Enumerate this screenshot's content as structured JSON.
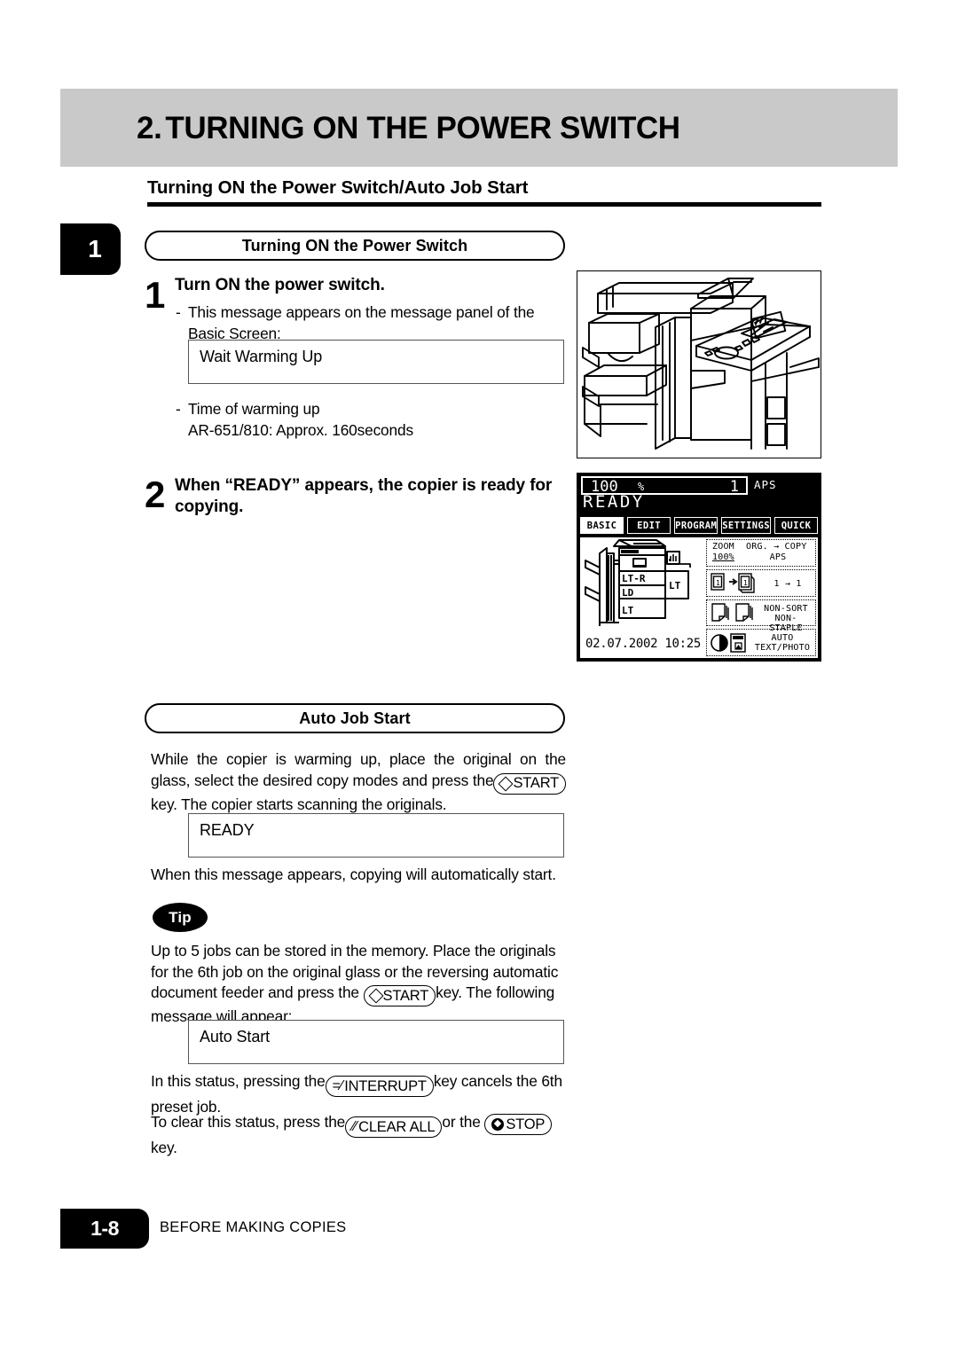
{
  "header": {
    "chapter_number": "2.",
    "title": "TURNING ON THE POWER SWITCH",
    "subtitle": "Turning ON the Power Switch/Auto Job Start",
    "chapter_tab": "1"
  },
  "sections": {
    "power_switch_pill": "Turning ON the Power Switch",
    "auto_job_start_pill": "Auto Job Start"
  },
  "step1": {
    "number": "1",
    "heading": "Turn ON the power switch.",
    "bullet1_dash": "-",
    "bullet1": "This message appears on the message panel of the Basic Screen:",
    "message": "Wait  Warming Up",
    "bullet2_dash": "-",
    "bullet2": "Time of warming up",
    "bullet2_detail": "AR-651/810: Approx. 160seconds"
  },
  "step2": {
    "number": "2",
    "heading_line1": "When “READY” appears, the  copier  is  ready  for",
    "heading_line2": "copying."
  },
  "auto_job_start": {
    "para1_a": "While the copier is warming up, place the original on the glass, select the desired copy modes and press the",
    "key_start": "START",
    "para1_b": "key. The copier starts scanning the originals.",
    "message": "READY",
    "para2": "When this message appears, copying will automatically start."
  },
  "tip": {
    "badge": "Tip",
    "para_a": "Up to 5 jobs can be stored in the memory. Place the originals for the 6th job on the original glass or the reversing automatic document feeder and press the",
    "key_start": "START",
    "para_b": "key. The following message will appear:",
    "message": "Auto Start",
    "para_c_a": "In this status, pressing the",
    "key_interrupt": "INTERRUPT",
    "para_c_b": "key cancels the 6th preset job.",
    "para_d_a": "To clear this status, press the",
    "key_clear_all": "CLEAR ALL",
    "para_d_b": "or the",
    "key_stop": "STOP",
    "para_d_c": "key."
  },
  "lcd": {
    "zoom_value": "100",
    "percent": "%",
    "copy_count": "1",
    "paper_mode": "APS",
    "status": "READY",
    "tabs": [
      {
        "label": "BASIC",
        "selected": true
      },
      {
        "label": "EDIT",
        "selected": false
      },
      {
        "label": "PROGRAM",
        "selected": false
      },
      {
        "label": "SETTINGS",
        "selected": false
      },
      {
        "label": "QUICK",
        "selected": false
      }
    ],
    "trays": {
      "upper": "LT-R",
      "middle": "LD",
      "lower": "LT",
      "side": "LT"
    },
    "datetime": "02.07.2002 10:25",
    "buttons": [
      {
        "left_label": "ZOOM",
        "left_value": "100%",
        "right_label": "ORG. → COPY",
        "right_value": "APS"
      },
      {
        "right_value": "1 → 1"
      },
      {
        "right_label": "NON-SORT",
        "right_value": "NON-STAPLE"
      },
      {
        "right_label": "AUTO",
        "right_value": "TEXT/PHOTO"
      }
    ]
  },
  "footer": {
    "page_number": "1-8",
    "section_name": "BEFORE MAKING COPIES"
  },
  "colors": {
    "header_bar": "#c9c9c9",
    "ink": "#000000",
    "paper": "#ffffff"
  }
}
